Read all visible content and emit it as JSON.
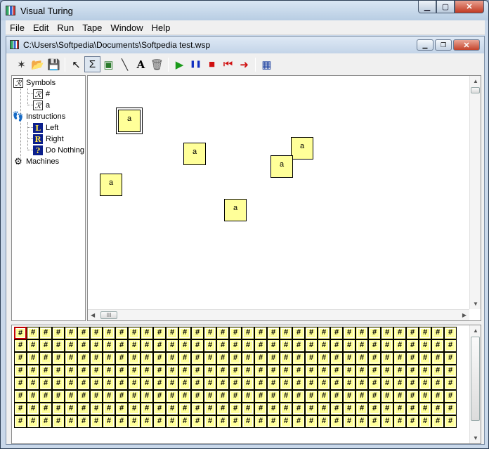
{
  "window": {
    "title": "Visual Turing"
  },
  "menu": [
    "File",
    "Edit",
    "Run",
    "Tape",
    "Window",
    "Help"
  ],
  "document": {
    "title": "C:\\Users\\Softpedia\\Documents\\Softpedia test.wsp"
  },
  "toolbar": {
    "buttons": [
      {
        "name": "new-icon",
        "glyph": "✶"
      },
      {
        "name": "open-folder-icon",
        "glyph": "📂"
      },
      {
        "name": "save-icon",
        "glyph": "💾"
      },
      {
        "name": "select-arrow-icon",
        "glyph": "↖"
      },
      {
        "name": "sigma-icon",
        "glyph": "Σ"
      },
      {
        "name": "computer-icon",
        "glyph": "▣"
      },
      {
        "name": "connect-line-icon",
        "glyph": "╲"
      },
      {
        "name": "text-icon",
        "glyph": "A"
      },
      {
        "name": "trash-icon",
        "glyph": "🗑"
      },
      {
        "name": "play-icon",
        "glyph": "▶"
      },
      {
        "name": "pause-icon",
        "glyph": "❚❚"
      },
      {
        "name": "stop-icon",
        "glyph": "■"
      },
      {
        "name": "rewind-icon",
        "glyph": "⏮"
      },
      {
        "name": "step-icon",
        "glyph": "➜"
      },
      {
        "name": "table-icon",
        "glyph": "▦"
      }
    ]
  },
  "tree": {
    "symbols_label": "Symbols",
    "symbols": [
      "#",
      "a"
    ],
    "instructions_label": "Instructions",
    "instructions": [
      {
        "icon": "L",
        "label": "Left"
      },
      {
        "icon": "R",
        "label": "Right"
      },
      {
        "icon": "?",
        "label": "Do Nothing"
      }
    ],
    "machines_label": "Machines",
    "symbol_icon_letter": "ℛ"
  },
  "canvas": {
    "states": [
      "a",
      "a",
      "a",
      "a",
      "a",
      "a"
    ],
    "hscroll_grip": "III"
  },
  "tape": {
    "symbol": "#",
    "rows": 8,
    "columns": 35
  },
  "colors": {
    "state_fill": "#ffff99",
    "tape_fill": "#ffff99",
    "head_border": "#c00000"
  }
}
